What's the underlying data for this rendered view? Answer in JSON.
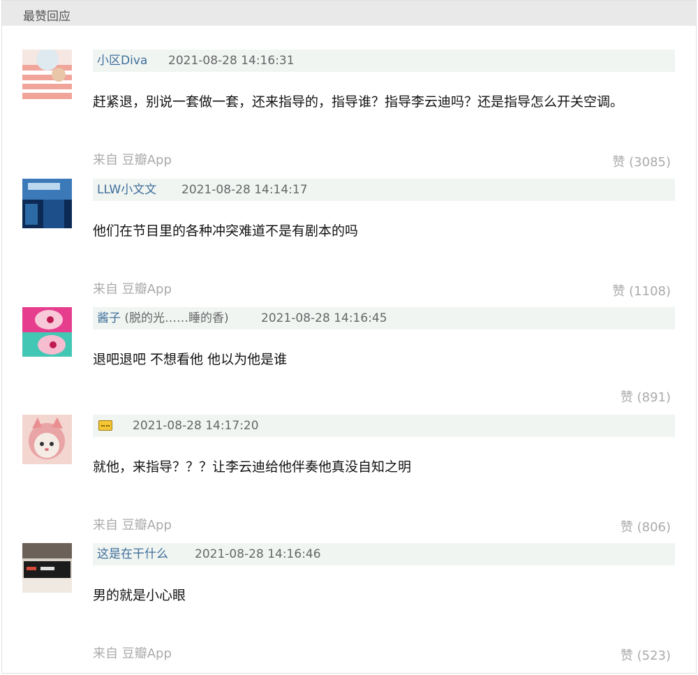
{
  "section": {
    "title": "最赞回应"
  },
  "comments": [
    {
      "author": "小区Diva",
      "author_sub": "",
      "time": "2021-08-28 14:16:31",
      "text": "赶紧退，别说一套做一套，还来指导的，指导谁？指导李云迪吗？还是指导怎么开关空调。",
      "source": "来自 豆瓣App",
      "likes": "赞 (3085)"
    },
    {
      "author": "LLW小文文",
      "author_sub": "",
      "time": "2021-08-28 14:14:17",
      "text": "他们在节目里的各种冲突难道不是有剧本的吗",
      "source": "来自 豆瓣App",
      "likes": "赞 (1108)"
    },
    {
      "author": "酱子",
      "author_sub": "(脱的光……睡的香)",
      "time": "2021-08-28 14:16:45",
      "text": "退吧退吧 不想看他 他以为他是谁",
      "source": "",
      "likes": "赞 (891)"
    },
    {
      "author": "",
      "author_sub": "",
      "time": "2021-08-28 14:17:20",
      "text": "就他，来指导？？？让李云迪给他伴奏他真没自知之明",
      "source": "来自 豆瓣App",
      "likes": "赞 (806)"
    },
    {
      "author": "这是在干什么",
      "author_sub": "",
      "time": "2021-08-28 14:16:46",
      "text": "男的就是小心眼",
      "source": "来自 豆瓣App",
      "likes": "赞 (523)"
    }
  ]
}
